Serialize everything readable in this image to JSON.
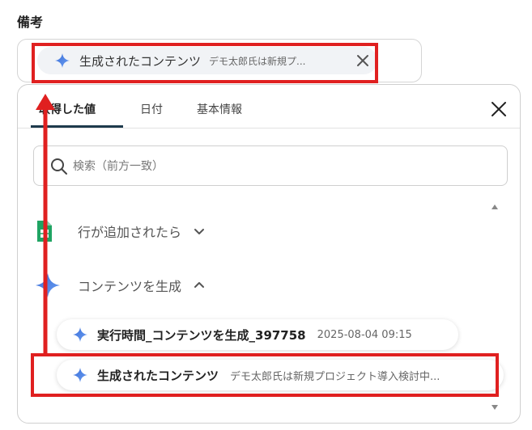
{
  "field": {
    "label": "備考",
    "chip": {
      "title": "生成されたコンテンツ",
      "value": "デモ太郎氏は新規プ..."
    }
  },
  "panel": {
    "tabs": [
      {
        "label": "取得した値"
      },
      {
        "label": "日付"
      },
      {
        "label": "基本情報"
      }
    ],
    "search": {
      "placeholder": "検索（前方一致）"
    },
    "groups": [
      {
        "label": "行が追加されたら",
        "icon": "google-sheets-icon",
        "expanded": false
      },
      {
        "label": "コンテンツを生成",
        "icon": "sparkle-icon",
        "expanded": true
      }
    ],
    "items": [
      {
        "title": "実行時間_コンテンツを生成_397758",
        "value": "2025-08-04 09:15"
      },
      {
        "title": "生成されたコンテンツ",
        "value": "デモ太郎氏は新規プロジェクト導入検討中..."
      }
    ]
  },
  "colors": {
    "highlight": "#e02020",
    "sparkle": "#4a7fe0",
    "sheets": "#1fa463",
    "tab_underline": "#1e3a4c"
  }
}
